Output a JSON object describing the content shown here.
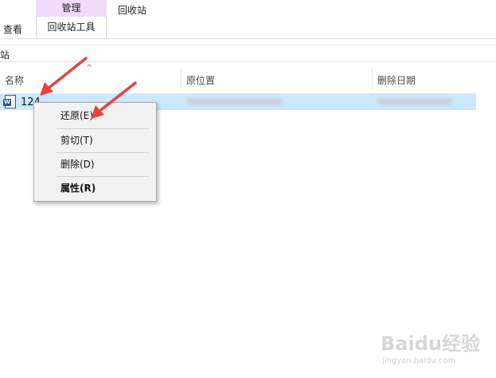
{
  "ribbon": {
    "manage_header": "管理",
    "recycle_bin_tab": "回收站",
    "view_tab": "查看",
    "tools_tab": "回收站工具"
  },
  "address": {
    "text": "站"
  },
  "columns": {
    "name": "名称",
    "original_location": "原位置",
    "date_deleted": "删除日期"
  },
  "file": {
    "name": "124",
    "icon": "word-doc-icon"
  },
  "context_menu": {
    "items": [
      "还原(E)",
      "剪切(T)",
      "删除(D)",
      "属性(R)"
    ]
  },
  "watermark": {
    "main": "Baidu经验",
    "sub": "jingyan.baidu.com"
  },
  "colors": {
    "manage_header_bg": "#eedcf8",
    "selection_bg": "#cce8ff",
    "arrow": "#e8413c"
  }
}
